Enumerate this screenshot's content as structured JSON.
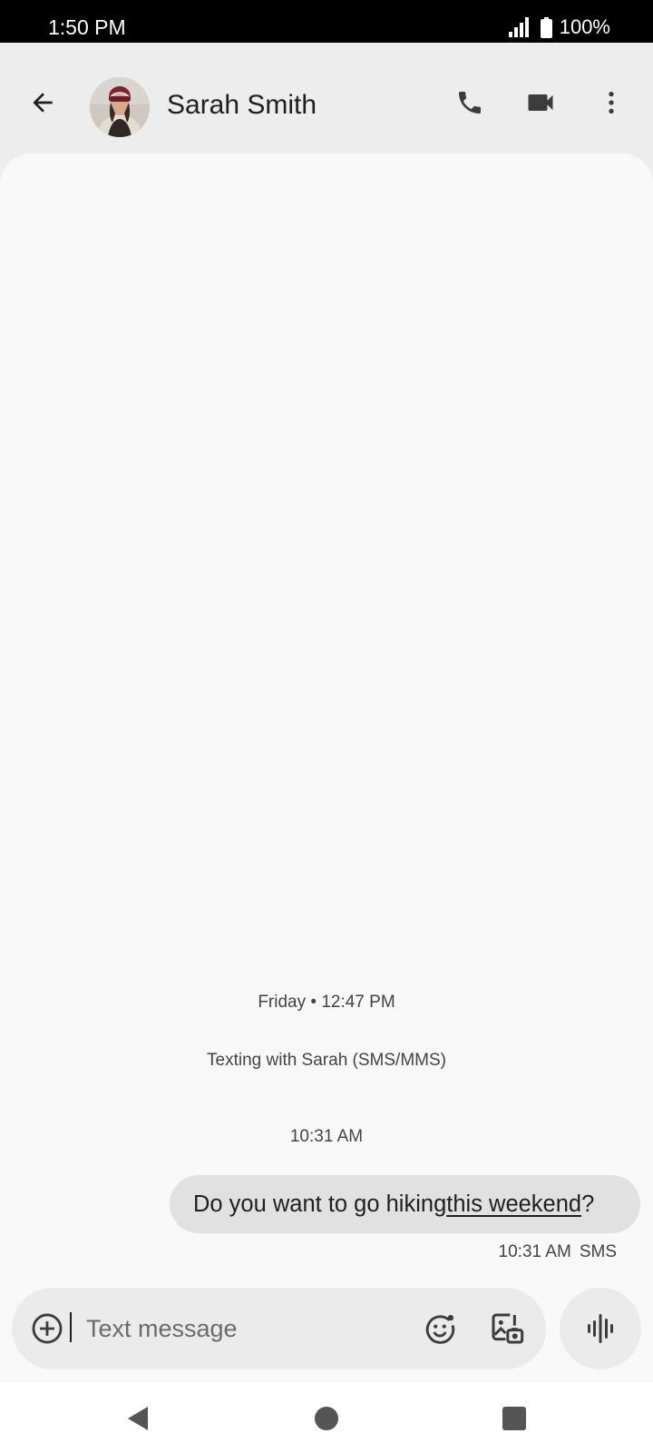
{
  "status_bar": {
    "time": "1:50 PM",
    "battery": "100%",
    "icons": [
      "signal-icon",
      "battery-icon"
    ]
  },
  "app_bar": {
    "contact_name": "Sarah Smith",
    "icons": [
      "back-arrow-icon",
      "phone-icon",
      "video-camera-icon",
      "more-vert-icon"
    ]
  },
  "conversation": {
    "date_divider": "Friday • 12:47 PM",
    "info": "Texting with Sarah (SMS/MMS)",
    "messages": [
      {
        "time": "10:31 AM",
        "text_before": "Do you want to go hiking ",
        "link_text": "this weekend",
        "text_after": "?",
        "meta_time": "10:31 AM",
        "meta_type": "SMS"
      }
    ]
  },
  "composer": {
    "placeholder": "Text message",
    "value": "",
    "icons": [
      "add-circle-icon",
      "emoji-icon",
      "gallery-icon",
      "voice-waveform-icon"
    ]
  },
  "nav_bar": {
    "icons": [
      "nav-back-icon",
      "nav-home-icon",
      "nav-recents-icon"
    ]
  },
  "colors": {
    "status_bar_bg": "#000000",
    "app_bar_bg": "#ededed",
    "conversation_bg": "#f8f8f8",
    "bubble_bg": "#e1e1e1",
    "text_primary": "#1f1f1f",
    "text_secondary": "#444444"
  }
}
